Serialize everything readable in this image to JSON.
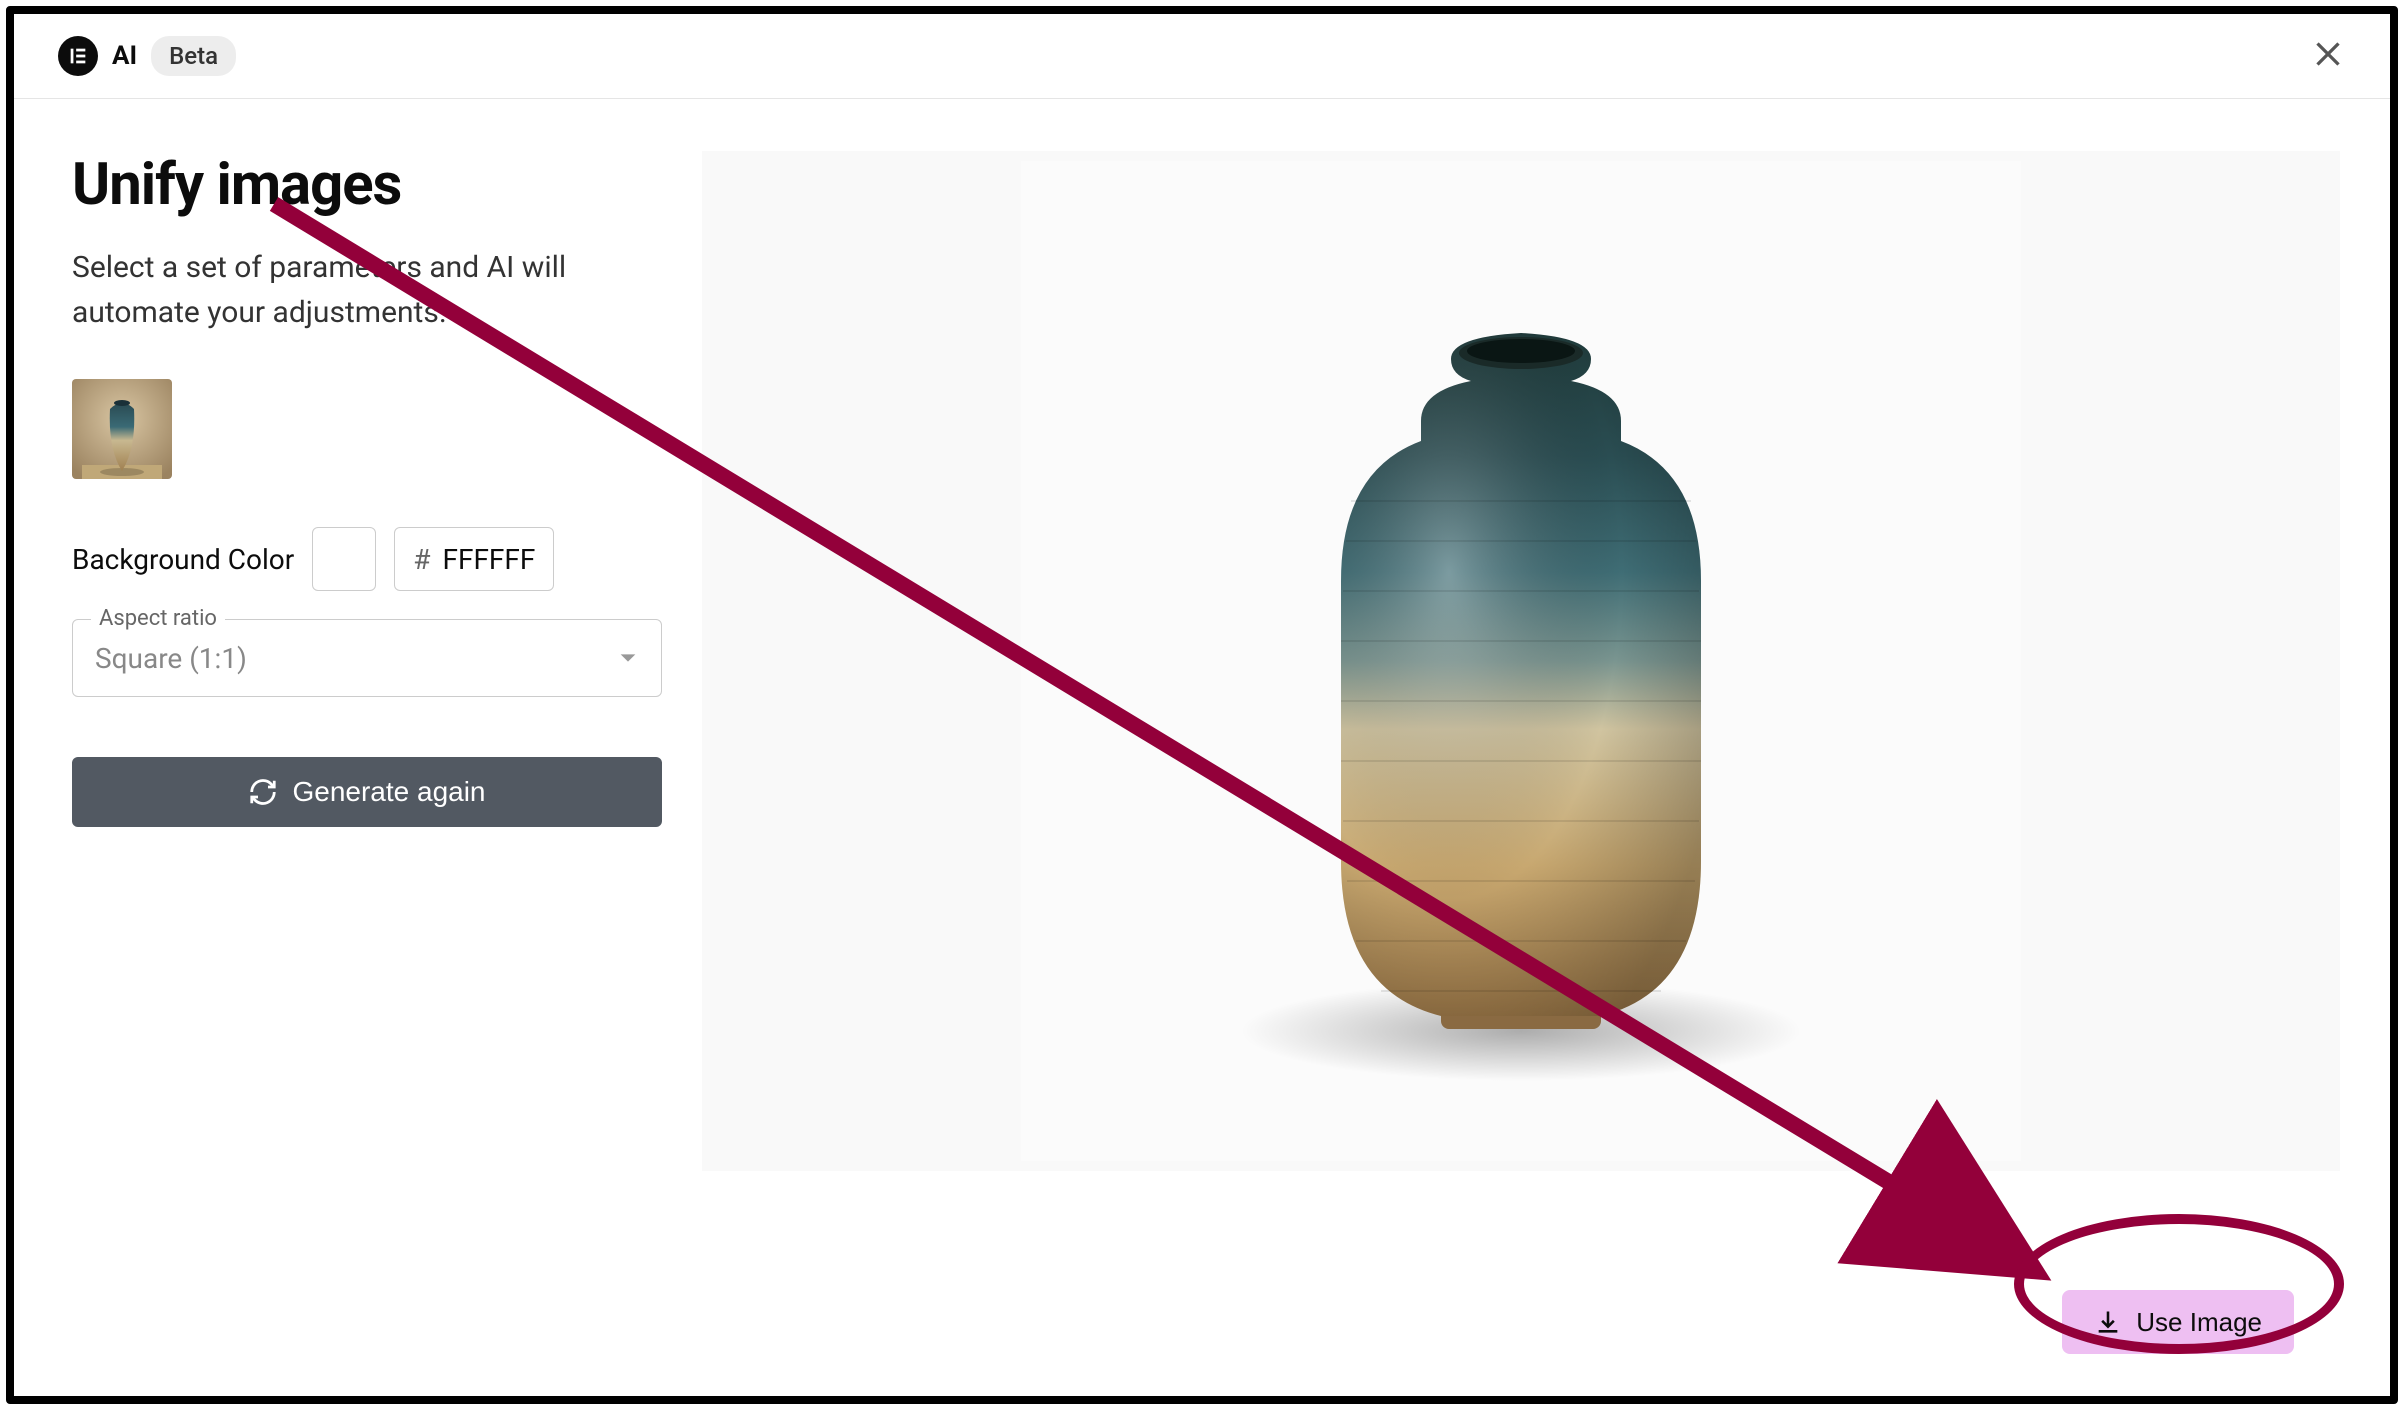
{
  "header": {
    "logo_text": "E",
    "ai_label": "AI",
    "beta_label": "Beta"
  },
  "page": {
    "title": "Unify images",
    "subtitle": "Select a set of parameters and AI will automate your adjustments."
  },
  "fields": {
    "bg_color_label": "Background Color",
    "hex_prefix": "#",
    "hex_value": "FFFFFF",
    "aspect_ratio_legend": "Aspect ratio",
    "aspect_ratio_value": "Square (1:1)"
  },
  "buttons": {
    "generate_again": "Generate again",
    "use_image": "Use Image"
  },
  "annotation": {
    "arrow_color": "#93003a"
  }
}
